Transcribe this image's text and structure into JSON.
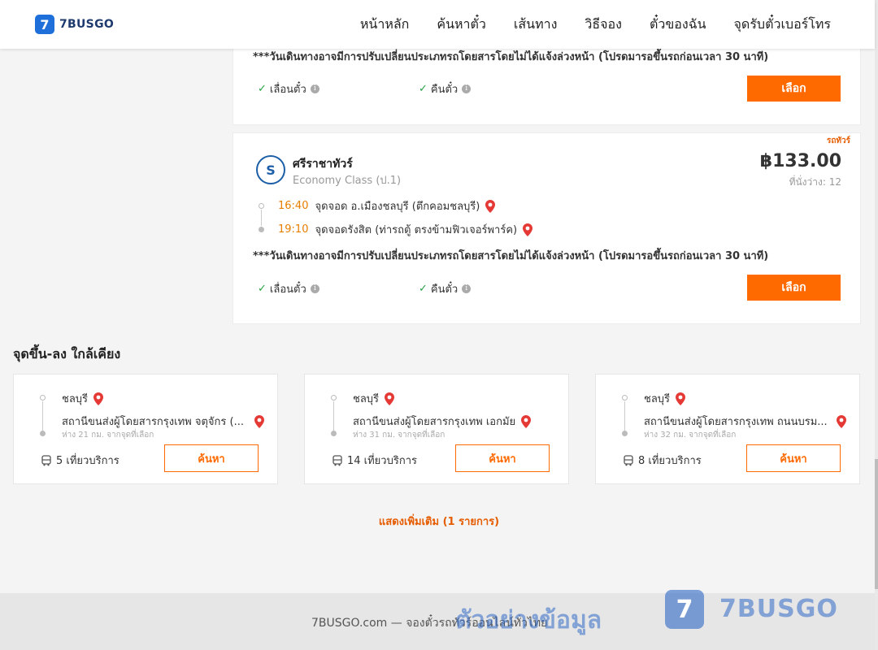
{
  "header": {
    "logo_mark": "7",
    "logo_text": "7BUSGO",
    "nav": [
      "หน้าหลัก",
      "ค้นหาตั๋ว",
      "เส้นทาง",
      "วิธีจอง",
      "ตั๋วของฉัน",
      "จุดรับตั๋วเบอร์โทร"
    ]
  },
  "trips": [
    {
      "note": "***วันเดินทางอาจมีการปรับเปลี่ยนประเภทรถโดยสารโดยไม่ได้แจ้งล่วงหน้า (โปรดมารอขึ้นรถก่อนเวลา 30 นาที)",
      "features": [
        "เลื่อนตั๋ว",
        "คืนตั๋ว"
      ],
      "select_label": "เลือก"
    },
    {
      "tag": "รถทัวร์",
      "operator": "ศรีราชาทัวร์",
      "operator_logo": "S",
      "class": "Economy Class (ป.1)",
      "price": "฿133.00",
      "seats": "ที่นั่งว่าง: 12",
      "depart_time": "16:40",
      "depart_stop": "จุดจอด อ.เมืองชลบุรี (ตึกคอมชลบุรี)",
      "arrive_time": "19:10",
      "arrive_stop": "จุดจอดรังสิต (ท่ารถตู้ ตรงข้ามฟิวเจอร์พาร์ค)",
      "note": "***วันเดินทางอาจมีการปรับเปลี่ยนประเภทรถโดยสารโดยไม่ได้แจ้งล่วงหน้า (โปรดมารอขึ้นรถก่อนเวลา 30 นาที)",
      "features": [
        "เลื่อนตั๋ว",
        "คืนตั๋ว"
      ],
      "select_label": "เลือก"
    }
  ],
  "nearby": {
    "title": "จุดขึ้น-ลง ใกล้เคียง",
    "items": [
      {
        "city": "ชลบุรี",
        "station": "สถานีขนส่งผู้โดยสารกรุงเทพ จตุจักร (...",
        "distance": "ห่าง 21 กม. จากจุดที่เลือก",
        "trips": "5 เที่ยวบริการ",
        "button": "ค้นหา"
      },
      {
        "city": "ชลบุรี",
        "station": "สถานีขนส่งผู้โดยสารกรุงเทพ เอกมัย",
        "distance": "ห่าง 31 กม. จากจุดที่เลือก",
        "trips": "14 เที่ยวบริการ",
        "button": "ค้นหา"
      },
      {
        "city": "ชลบุรี",
        "station": "สถานีขนส่งผู้โดยสารกรุงเทพ ถนนบรม...",
        "distance": "ห่าง 32 กม. จากจุดที่เลือก",
        "trips": "8 เที่ยวบริการ",
        "button": "ค้นหา"
      }
    ],
    "show_more": "แสดงเพิ่มเติม (1 รายการ)"
  },
  "footer": {
    "text": "7BUSGO.com — จองตั๋วรถทัวร์ออนไลน์ทั่วไทย",
    "watermark_text": "ตัวอย่างข้อมูล",
    "watermark_logo": "7",
    "watermark_brand": "7BUSGO"
  },
  "colors": {
    "accent": "#ff6a00",
    "brand": "#1e6fd9",
    "time": "#e67e00",
    "check": "#2aa043"
  }
}
